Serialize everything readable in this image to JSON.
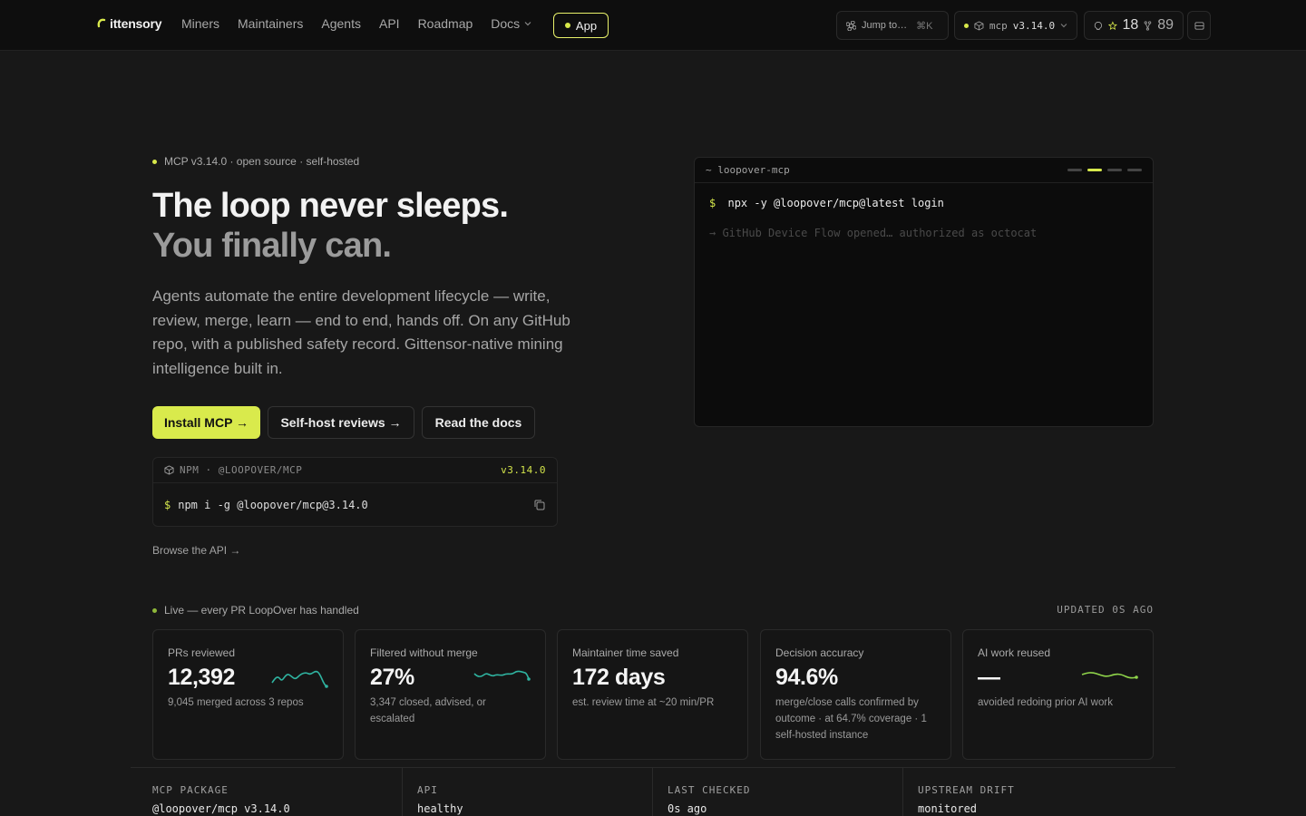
{
  "nav": {
    "brand": "ittensory",
    "links": [
      "Miners",
      "Maintainers",
      "Agents",
      "API",
      "Roadmap",
      "Docs"
    ],
    "app_label": "App",
    "jump_label": "Jump to…",
    "jump_kbd": "⌘K",
    "mcp_label": "mcp",
    "mcp_version": "v3.14.0",
    "stars": "18",
    "forks": "89"
  },
  "hero": {
    "eyebrow": "MCP v3.14.0 · open source · self-hosted",
    "title_line1": "The loop never sleeps.",
    "title_line2": "You finally can.",
    "lead": "Agents automate the entire development lifecycle — write, review, merge, learn — end to end, hands off. On any GitHub repo, with a published safety record. Gittensor-native mining intelligence built in.",
    "primary_cta": "Install MCP →",
    "secondary_cta": "Self-host reviews →",
    "tertiary_cta": "Read the docs",
    "npm_label": "NPM · @LOOPOVER/MCP",
    "npm_version": "v3.14.0",
    "npm_prompt": "$",
    "npm_command": "npm i -g @loopover/mcp@3.14.0",
    "browse_api": "Browse the API →"
  },
  "terminal": {
    "title": "~ loopover-mcp",
    "prompt": "$",
    "command": "npx -y @loopover/mcp@latest login",
    "output": "→ GitHub Device Flow opened… authorized as octocat",
    "active_tab": 2,
    "tab_count": 4
  },
  "live": {
    "label": "Live — every PR LoopOver has handled",
    "updated": "UPDATED 0S AGO",
    "cards": [
      {
        "label": "PRs reviewed",
        "value": "12,392",
        "sub": "9,045 merged across 3 repos"
      },
      {
        "label": "Filtered without merge",
        "value": "27%",
        "sub": "3,347 closed, advised, or escalated"
      },
      {
        "label": "Maintainer time saved",
        "value": "172 days",
        "sub": "est. review time at ~20 min/PR"
      },
      {
        "label": "Decision accuracy",
        "value": "94.6%",
        "sub": "merge/close calls confirmed by outcome · at 64.7% coverage · 1 self-hosted instance"
      },
      {
        "label": "AI work reused",
        "value": "—",
        "sub": "avoided redoing prior AI work"
      }
    ]
  },
  "status": [
    {
      "key": "MCP PACKAGE",
      "value": "@loopover/mcp v3.14.0"
    },
    {
      "key": "API",
      "value": "healthy"
    },
    {
      "key": "LAST CHECKED",
      "value": "0s ago"
    },
    {
      "key": "UPSTREAM DRIFT",
      "value": "monitored"
    }
  ],
  "colors": {
    "accent": "#d9ea4c",
    "spark_teal": "#2fb3a0",
    "spark_lime": "#8fd44a",
    "background": "#181818"
  },
  "icons": [
    "brand-logo-icon",
    "command-icon",
    "package-icon",
    "github-icon",
    "star-icon",
    "fork-icon",
    "layout-icon",
    "copy-icon",
    "chevron-down-icon"
  ]
}
